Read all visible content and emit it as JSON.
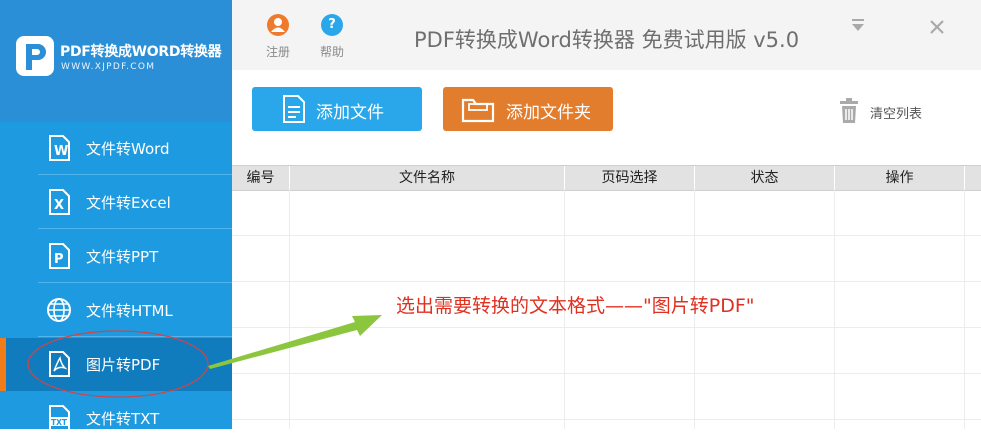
{
  "app": {
    "logo_title": "PDF转换成WORD转换器",
    "logo_url": "WWW.XJPDF.COM",
    "window_title": "PDF转换成Word转换器 免费试用版 v5.0"
  },
  "topbar": {
    "register_label": "注册",
    "help_label": "帮助",
    "minimize": "▼",
    "close": "✕"
  },
  "sidebar": {
    "items": [
      {
        "label": "文件转Word",
        "icon": "word-file-icon"
      },
      {
        "label": "文件转Excel",
        "icon": "excel-file-icon"
      },
      {
        "label": "文件转PPT",
        "icon": "ppt-file-icon"
      },
      {
        "label": "文件转HTML",
        "icon": "globe-icon"
      },
      {
        "label": "图片转PDF",
        "icon": "pdf-file-icon",
        "active": true
      },
      {
        "label": "文件转TXT",
        "icon": "txt-file-icon"
      }
    ]
  },
  "actions": {
    "add_file": "添加文件",
    "add_folder": "添加文件夹",
    "clear_list": "清空列表"
  },
  "table": {
    "columns": [
      "编号",
      "文件名称",
      "页码选择",
      "状态",
      "操作"
    ]
  },
  "annotation": {
    "text": "选出需要转换的文本格式——\"图片转PDF\""
  },
  "colors": {
    "sidebar": "#1e9be0",
    "active_item": "#117cbd",
    "active_bar": "#f07d1a",
    "add_file_button": "#2aa7ea",
    "add_folder_button": "#e37d2e",
    "annotation": "#e03020",
    "arrow": "#8cc63f"
  }
}
